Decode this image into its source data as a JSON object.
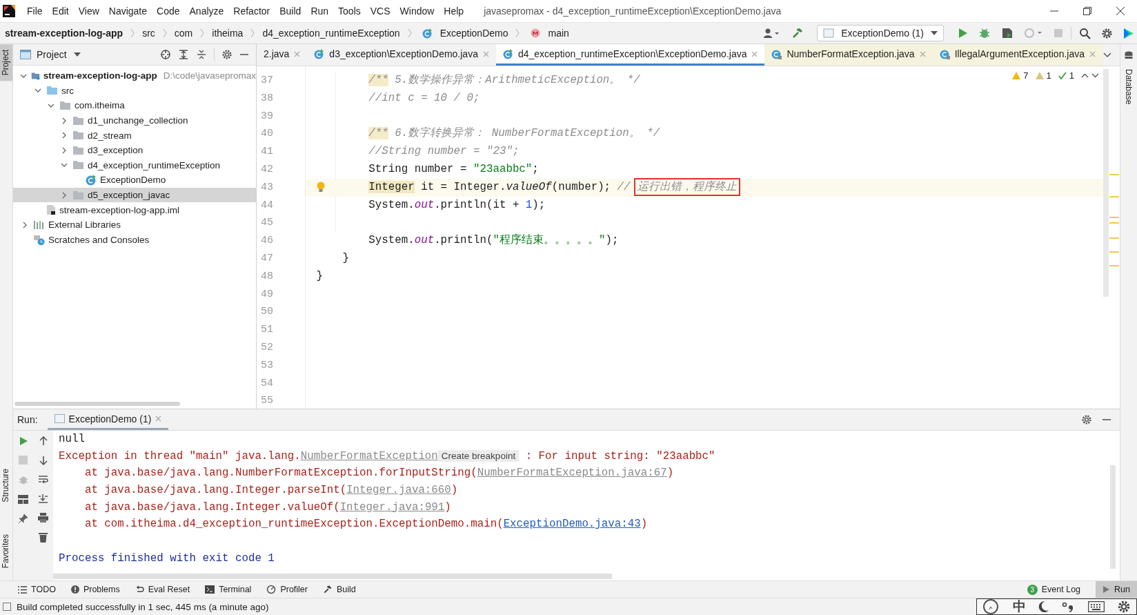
{
  "window": {
    "title": "javasepromax - d4_exception_runtimeException\\ExceptionDemo.java"
  },
  "menu": [
    "File",
    "Edit",
    "View",
    "Navigate",
    "Code",
    "Analyze",
    "Refactor",
    "Build",
    "Run",
    "Tools",
    "VCS",
    "Window",
    "Help"
  ],
  "breadcrumbs": [
    {
      "kind": "module",
      "label": "stream-exception-log-app"
    },
    {
      "kind": "folder",
      "label": "src"
    },
    {
      "kind": "folder",
      "label": "com"
    },
    {
      "kind": "folder",
      "label": "itheima"
    },
    {
      "kind": "folder",
      "label": "d4_exception_runtimeException"
    },
    {
      "kind": "class",
      "label": "ExceptionDemo"
    },
    {
      "kind": "method",
      "label": "main"
    }
  ],
  "run_config": "ExceptionDemo (1)",
  "tool_strips": {
    "left_top": [
      {
        "label": "Project",
        "selected": true
      }
    ],
    "left_bottom": [
      {
        "label": "Structure",
        "selected": false
      },
      {
        "label": "Favorites",
        "selected": false
      }
    ],
    "right": [
      {
        "label": "Database",
        "selected": false
      }
    ]
  },
  "project_panel": {
    "title": "Project",
    "tree": [
      {
        "kind": "module",
        "label": "stream-exception-log-app",
        "path": "D:\\code\\javasepromax",
        "expanded": true,
        "selected": false,
        "children": [
          {
            "kind": "source",
            "label": "src",
            "expanded": true,
            "selected": false,
            "children": [
              {
                "kind": "package",
                "label": "com.itheima",
                "expanded": true,
                "selected": false,
                "children": [
                  {
                    "kind": "package",
                    "label": "d1_unchange_collection",
                    "expanded": false,
                    "selected": false
                  },
                  {
                    "kind": "package",
                    "label": "d2_stream",
                    "expanded": false,
                    "selected": false
                  },
                  {
                    "kind": "package",
                    "label": "d3_exception",
                    "expanded": false,
                    "selected": false
                  },
                  {
                    "kind": "package",
                    "label": "d4_exception_runtimeException",
                    "expanded": true,
                    "selected": false,
                    "children": [
                      {
                        "kind": "class",
                        "label": "ExceptionDemo",
                        "selected": false
                      }
                    ]
                  },
                  {
                    "kind": "package",
                    "label": "d5_exception_javac",
                    "expanded": false,
                    "selected": true
                  }
                ]
              }
            ]
          },
          {
            "kind": "iml",
            "label": "stream-exception-log-app.iml",
            "selected": false
          }
        ]
      },
      {
        "kind": "libraries",
        "label": "External Libraries",
        "expanded": false,
        "selected": false
      },
      {
        "kind": "scratches",
        "label": "Scratches and Consoles",
        "selected": false
      }
    ]
  },
  "editor_tabs": [
    {
      "kind": "partial",
      "label": "2.java",
      "selected": false
    },
    {
      "kind": "class",
      "label": "d3_exception\\ExceptionDemo.java",
      "selected": false
    },
    {
      "kind": "class",
      "label": "d4_exception_runtimeException\\ExceptionDemo.java",
      "selected": true
    },
    {
      "kind": "library",
      "label": "NumberFormatException.java",
      "selected": false
    },
    {
      "kind": "library",
      "label": "IllegalArgumentException.java",
      "selected": false
    }
  ],
  "inspections": {
    "warnings": "7",
    "weak_warnings": "1",
    "passed": "1"
  },
  "code_lines": [
    {
      "n": "37",
      "current": false,
      "tokens": [
        {
          "kind": "doc-open",
          "text": "        /**"
        },
        {
          "kind": "comment",
          "text": " 5.数学操作异常：ArithmeticException。 */"
        }
      ]
    },
    {
      "n": "38",
      "current": false,
      "tokens": [
        {
          "kind": "comment",
          "text": "        //int c = 10 / 0;"
        }
      ]
    },
    {
      "n": "39",
      "current": false
    },
    {
      "n": "40",
      "current": false,
      "tokens": [
        {
          "kind": "doc-open",
          "text": "        /**"
        },
        {
          "kind": "comment",
          "text": " 6.数字转换异常： NumberFormatException。 */"
        }
      ]
    },
    {
      "n": "41",
      "current": false,
      "tokens": [
        {
          "kind": "comment",
          "text": "        //String number = \"23\";"
        }
      ]
    },
    {
      "n": "42",
      "current": false,
      "tokens": [
        {
          "kind": "plain",
          "text": "        String number = "
        },
        {
          "kind": "string",
          "text": "\"23aabbc\""
        },
        {
          "kind": "plain",
          "text": ";"
        }
      ]
    },
    {
      "n": "43",
      "current": true,
      "bulb": true,
      "tokens": [
        {
          "kind": "usage",
          "text": "        Integer"
        },
        {
          "kind": "plain",
          "text": " it = Integer."
        },
        {
          "kind": "method",
          "text": "valueOf"
        },
        {
          "kind": "plain",
          "text": "(number); "
        },
        {
          "kind": "comment",
          "text": "// "
        },
        {
          "kind": "boxed",
          "text": "运行出错，程序终止"
        }
      ]
    },
    {
      "n": "44",
      "current": false,
      "tokens": [
        {
          "kind": "plain",
          "text": "        System."
        },
        {
          "kind": "static",
          "text": "out"
        },
        {
          "kind": "plain",
          "text": ".println(it + "
        },
        {
          "kind": "number",
          "text": "1"
        },
        {
          "kind": "plain",
          "text": ");"
        }
      ]
    },
    {
      "n": "45",
      "current": false
    },
    {
      "n": "46",
      "current": false,
      "tokens": [
        {
          "kind": "plain",
          "text": "        System."
        },
        {
          "kind": "static",
          "text": "out"
        },
        {
          "kind": "plain",
          "text": ".println("
        },
        {
          "kind": "string",
          "text": "\"程序结束。。。。。\""
        },
        {
          "kind": "plain",
          "text": ");"
        }
      ]
    },
    {
      "n": "47",
      "current": false,
      "tokens": [
        {
          "kind": "plain",
          "text": "    }"
        }
      ]
    },
    {
      "n": "48",
      "current": false,
      "tokens": [
        {
          "kind": "plain",
          "text": "}"
        }
      ]
    },
    {
      "n": "49",
      "current": false
    },
    {
      "n": "50",
      "current": false
    },
    {
      "n": "51",
      "current": false
    },
    {
      "n": "52",
      "current": false
    },
    {
      "n": "53",
      "current": false
    },
    {
      "n": "54",
      "current": false
    },
    {
      "n": "55",
      "current": false
    }
  ],
  "run_panel": {
    "label": "Run:",
    "tab": "ExceptionDemo (1)",
    "lines": [
      {
        "kind": "text",
        "segments": [
          {
            "kind": "out",
            "text": "null"
          }
        ]
      },
      {
        "kind": "text",
        "segments": [
          {
            "kind": "error",
            "text": "Exception in thread \"main\" java.lang."
          },
          {
            "kind": "link",
            "text": "NumberFormatException"
          },
          {
            "kind": "hint",
            "text": "Create breakpoint"
          },
          {
            "kind": "error",
            "text": " : For input string: \"23aabbc\""
          }
        ]
      },
      {
        "kind": "text",
        "segments": [
          {
            "kind": "error",
            "text": "    at java.base/java.lang.NumberFormatException.forInputString("
          },
          {
            "kind": "link",
            "text": "NumberFormatException.java:67"
          },
          {
            "kind": "error",
            "text": ")"
          }
        ]
      },
      {
        "kind": "text",
        "segments": [
          {
            "kind": "error",
            "text": "    at java.base/java.lang.Integer.parseInt("
          },
          {
            "kind": "link",
            "text": "Integer.java:660"
          },
          {
            "kind": "error",
            "text": ")"
          }
        ]
      },
      {
        "kind": "text",
        "segments": [
          {
            "kind": "error",
            "text": "    at java.base/java.lang.Integer.valueOf("
          },
          {
            "kind": "link",
            "text": "Integer.java:991"
          },
          {
            "kind": "error",
            "text": ")"
          }
        ]
      },
      {
        "kind": "text",
        "segments": [
          {
            "kind": "error",
            "text": "    at com.itheima.d4_exception_runtimeException.ExceptionDemo.main("
          },
          {
            "kind": "source-link",
            "text": "ExceptionDemo.java:43"
          },
          {
            "kind": "error",
            "text": ")"
          }
        ]
      },
      {
        "kind": "blank"
      },
      {
        "kind": "text",
        "segments": [
          {
            "kind": "exit",
            "text": "Process finished with exit code 1"
          }
        ]
      }
    ]
  },
  "bottom_tools": [
    {
      "kind": "todo",
      "label": "TODO"
    },
    {
      "kind": "problems",
      "label": "Problems"
    },
    {
      "kind": "reset",
      "label": "Eval Reset"
    },
    {
      "kind": "terminal",
      "label": "Terminal"
    },
    {
      "kind": "profiler",
      "label": "Profiler"
    },
    {
      "kind": "build",
      "label": "Build"
    }
  ],
  "right_tools": [
    {
      "kind": "event-log",
      "label": "Event Log",
      "badge": "3",
      "selected": false
    },
    {
      "kind": "run",
      "label": "Run",
      "selected": true
    }
  ],
  "status_bar": {
    "message": "Build completed successfully in 1 sec, 445 ms (a minute ago)"
  },
  "ime_bar": {
    "mode": "中"
  }
}
